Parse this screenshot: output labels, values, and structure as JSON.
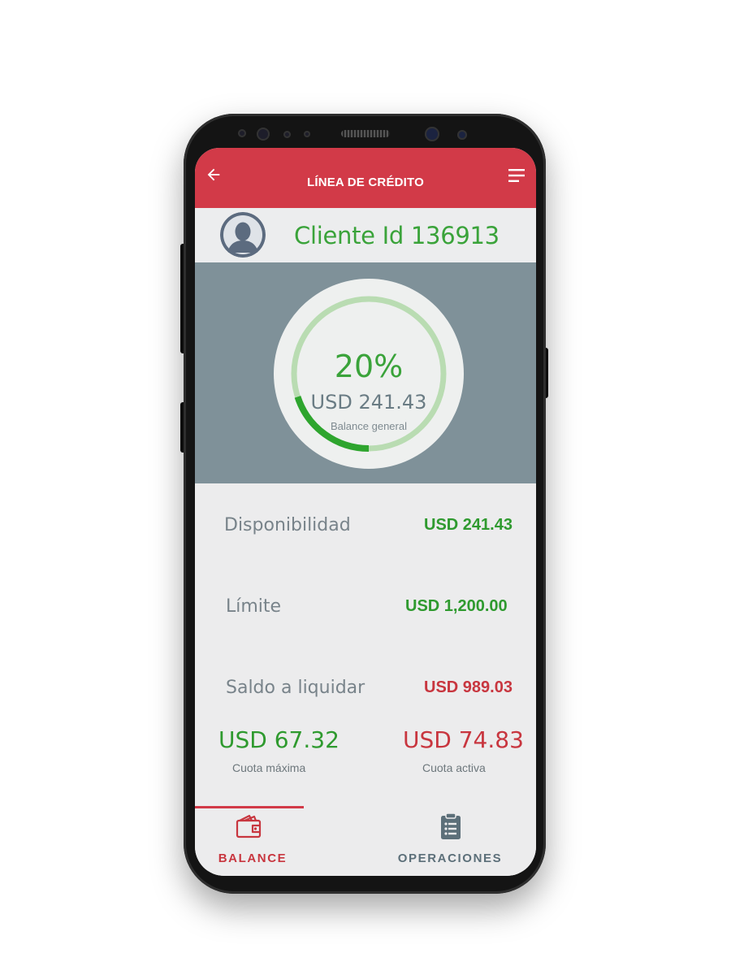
{
  "appbar": {
    "title": "LÍNEA DE CRÉDITO",
    "back_icon": "arrow-left-icon",
    "menu_icon": "menu-icon",
    "color": "#d23a48"
  },
  "client": {
    "name": "Cliente Id 136913",
    "avatar_icon": "user-avatar-icon"
  },
  "gauge": {
    "percent_label": "20%",
    "percent_value": 20,
    "amount": "USD 241.43",
    "caption": "Balance general",
    "progress_color": "#2ea52e",
    "track_color": "#b9dcb2"
  },
  "details": {
    "rows": [
      {
        "label": "Disponibilidad",
        "value": "USD 241.43",
        "status": "positive"
      },
      {
        "label": "Límite",
        "value": "USD 1,200.00",
        "status": "positive"
      },
      {
        "label": "Saldo a liquidar",
        "value": "USD 989.03",
        "status": "negative"
      }
    ],
    "quotas": [
      {
        "value": "USD 67.32",
        "caption": "Cuota máxima",
        "status": "positive"
      },
      {
        "value": "USD 74.83",
        "caption": "Cuota activa",
        "status": "negative"
      }
    ]
  },
  "tabs": [
    {
      "label": "BALANCE",
      "icon": "wallet-icon",
      "active": true
    },
    {
      "label": "OPERACIONES",
      "icon": "clipboard-list-icon",
      "active": false
    }
  ],
  "colors": {
    "positive": "#2f9a2f",
    "negative": "#c8363f",
    "inactive_tab": "#5c6f79"
  }
}
